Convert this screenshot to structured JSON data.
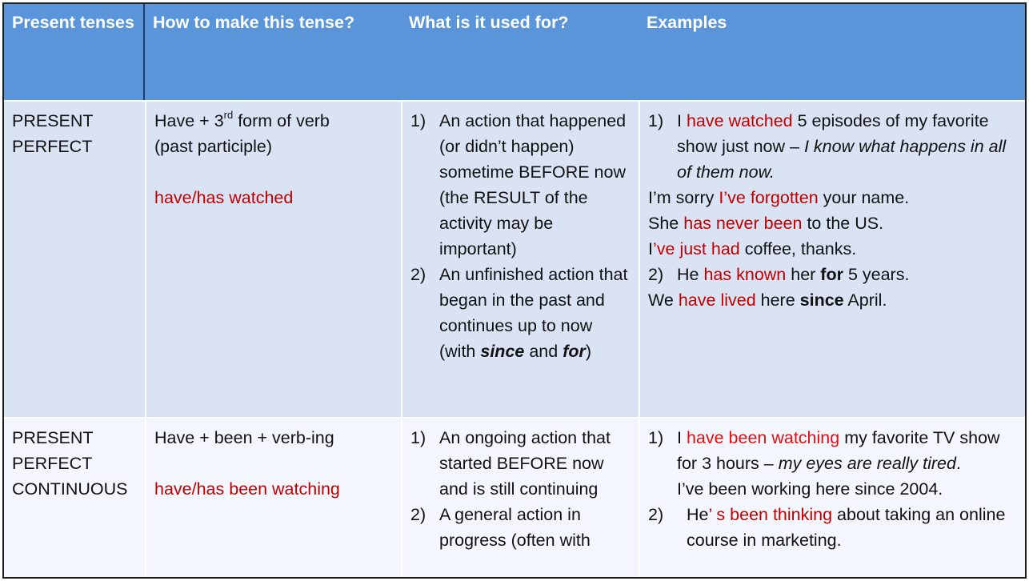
{
  "header": {
    "col1": "Present tenses",
    "col2": "How to make this tense?",
    "col3": "What is it used for?",
    "col4": "Examples"
  },
  "rows": [
    {
      "tense_line1": "PRESENT",
      "tense_line2": "PERFECT",
      "form_pre": "Have + 3",
      "form_sup": "rd",
      "form_post": " form of verb",
      "form_line2": "(past participle)",
      "form_example": "have/has watched",
      "uses": [
        {
          "num": "1)",
          "text": "An action that happened (or didn’t happen) sometime BEFORE now (the RESULT of the activity may be important)"
        },
        {
          "num": "2)",
          "text_pre": "An unfinished action that began in the past and continues up to now (with ",
          "kw1": "since",
          "text_mid": " and ",
          "kw2": "for",
          "text_post": ")"
        }
      ],
      "examples": {
        "e1_num": "1)",
        "e1_pre": "I ",
        "e1_red": "have watched",
        "e1_post": " 5 episodes of my favorite show just now – ",
        "e1_italic": "I know what happens in all of them now.",
        "e2_pre": "I’m sorry ",
        "e2_red": "I’ve forgotten",
        "e2_post": " your name.",
        "e3_pre": "She ",
        "e3_red": "has never been",
        "e3_post": " to the US.",
        "e4_pre": "I",
        "e4_red": "’ve just had",
        "e4_post": " coffee, thanks.",
        "e5_num": "2)",
        "e5_pre": "He ",
        "e5_red": "has known",
        "e5_mid": " her ",
        "e5_bold": "for",
        "e5_post": " 5 years.",
        "e6_pre": "We ",
        "e6_red": "have lived",
        "e6_mid": " here ",
        "e6_bold": "since",
        "e6_post": " April."
      }
    },
    {
      "tense_line1": "PRESENT",
      "tense_line2": "PERFECT",
      "tense_line3": "CONTINUOUS",
      "form_line1": "Have + been + verb-ing",
      "form_example": "have/has been watching",
      "uses": [
        {
          "num": "1)",
          "text": "An ongoing action that started BEFORE now and is still continuing"
        },
        {
          "num": "2)",
          "text": "A general action in progress (often with"
        }
      ],
      "examples": {
        "e1_num": "1)",
        "e1_pre": "I ",
        "e1_red": "have been watching",
        "e1_post": " my favorite TV show for 3 hours – ",
        "e1_italic": "my eyes are really tired",
        "e1_end": ".",
        "e2_text": "I’ve been working here since 2004.",
        "e3_num": "2)",
        "e3_pre": "He",
        "e3_red": "’ s been thinking",
        "e3_post": " about taking an online course in marketing."
      }
    }
  ],
  "colors": {
    "header_bg": "#5b95d9",
    "row1_bg": "#dae3f3",
    "row2_bg": "#f3f6fd",
    "highlight_red": "#c00000"
  }
}
